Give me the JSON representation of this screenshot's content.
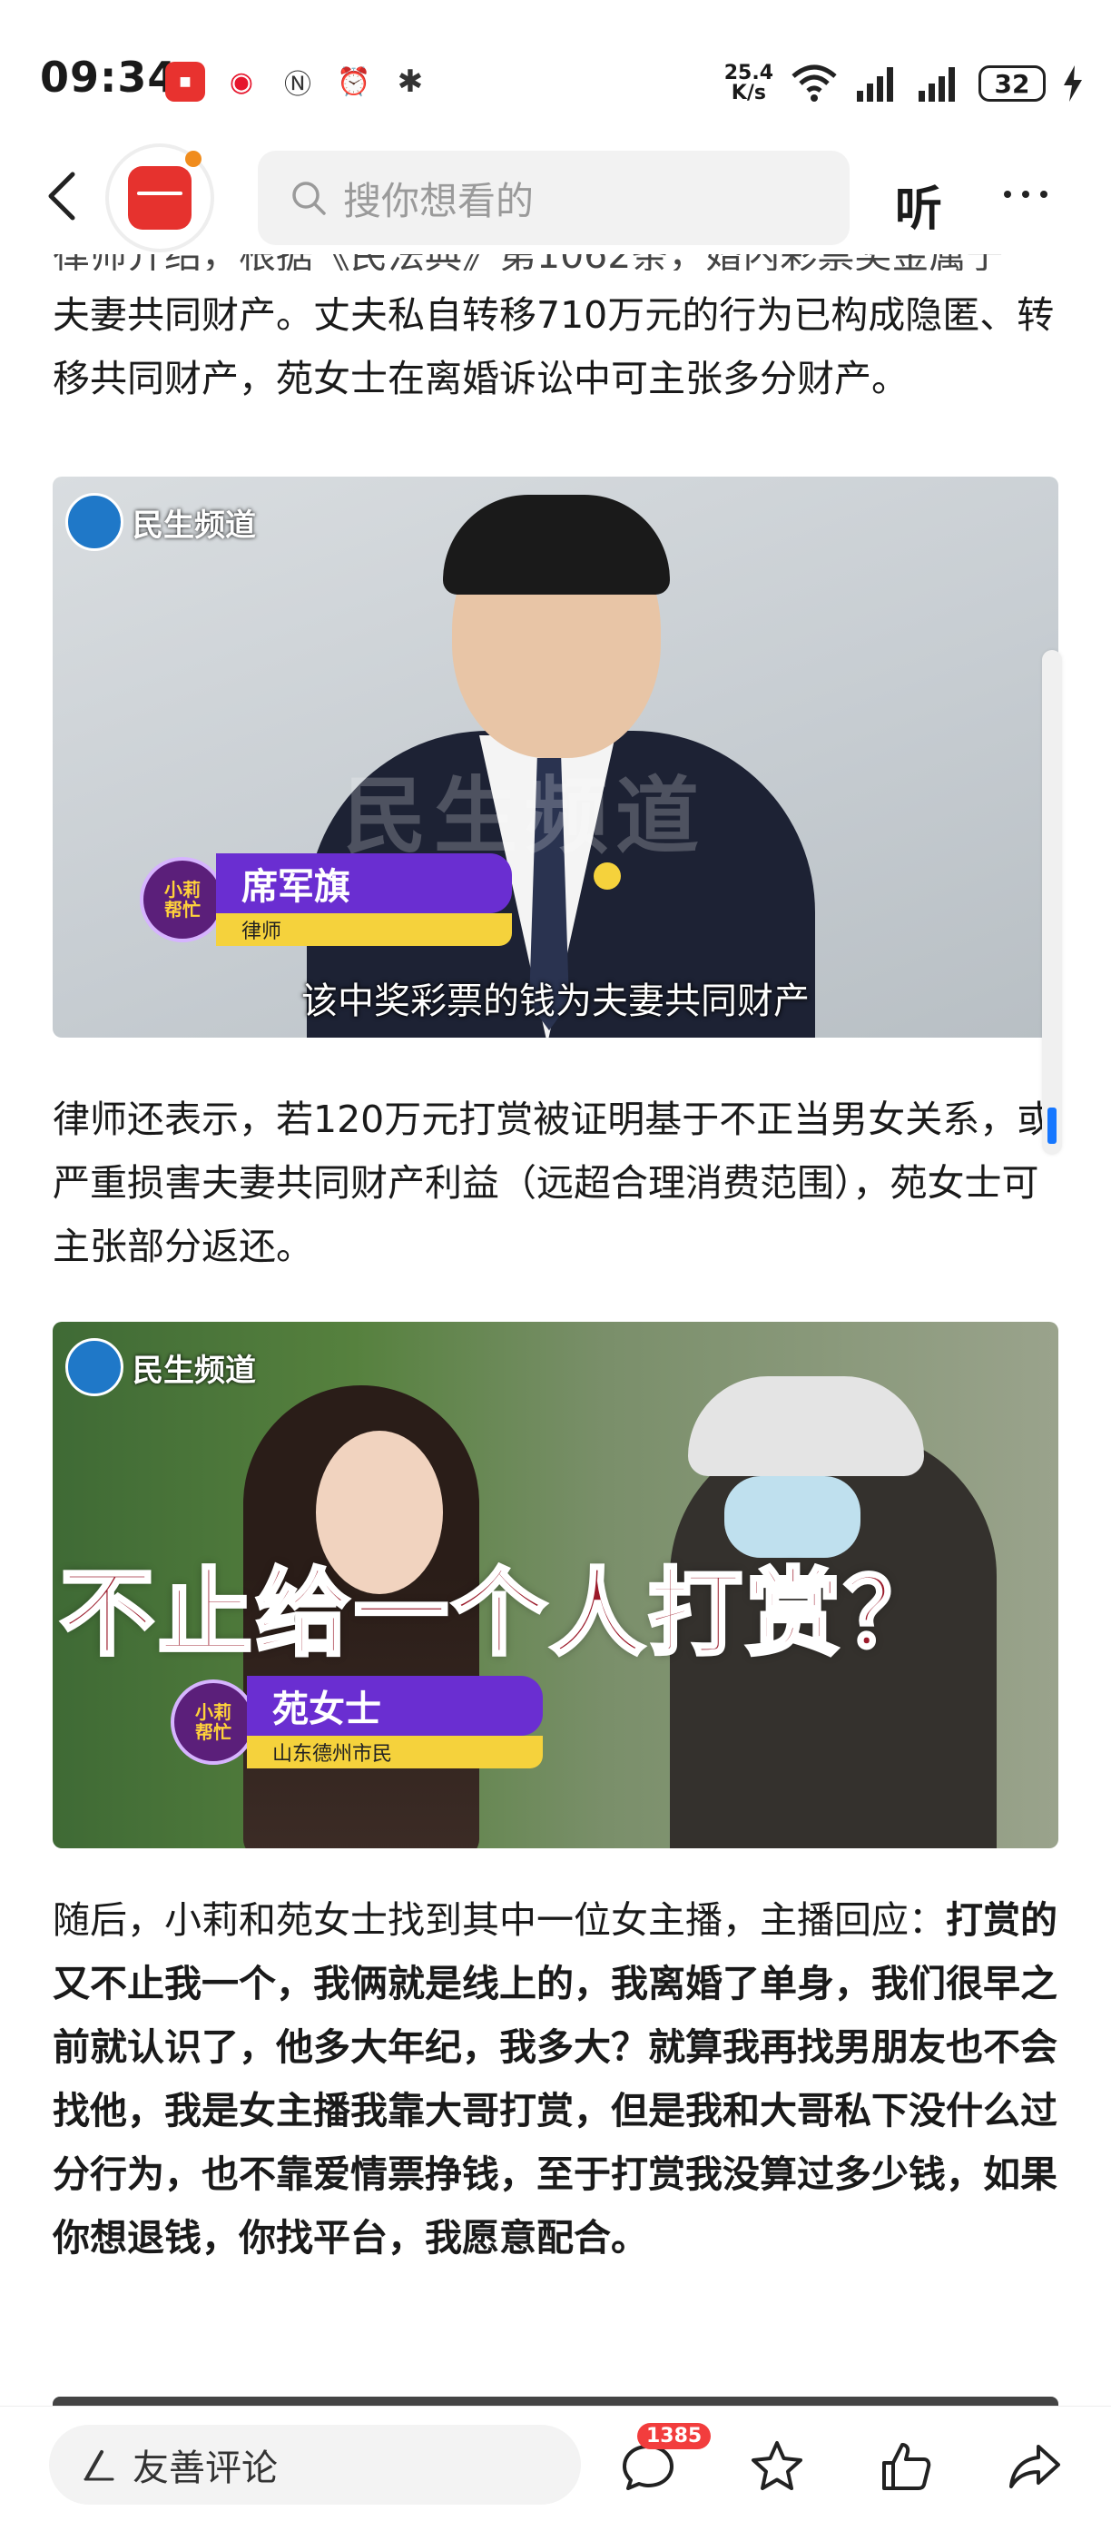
{
  "status_bar": {
    "time": "09:34",
    "net_speed": "25.4",
    "net_unit": "K/s",
    "battery": "32"
  },
  "nav": {
    "search_placeholder": "搜你想看的",
    "listen_label": "听"
  },
  "article": {
    "partial_line": "律师介绍，根据《民法典》第1062条，婚内彩票奖金属于",
    "para1": "夫妻共同财产。丈夫私自转移710万元的行为已构成隐匿、转移共同财产，苑女士在离婚诉讼中可主张多分财产。",
    "image1": {
      "channel_logo": "民生频道",
      "watermark": "民生频道",
      "person_name": "席军旗",
      "person_role": "律师",
      "subtitle": "该中奖彩票的钱为夫妻共同财产"
    },
    "para2": "律师还表示，若120万元打赏被证明基于不正当男女关系，或严重损害夫妻共同财产利益（远超合理消费范围），苑女士可主张部分返还。",
    "image2": {
      "channel_logo": "民生频道",
      "caption": "不止给一个人打赏？",
      "person_name": "苑女士",
      "person_role": "山东德州市民"
    },
    "para3_lead": "随后，小莉和苑女士找到其中一位女主播，主播回应：",
    "para3_bold": "打赏的又不止我一个，我俩就是线上的，我离婚了单身，我们很早之前就认识了，他多大年纪，我多大？就算我再找男朋友也不会找他，我是女主播我靠大哥打赏，但是我和大哥私下没什么过分行为，也不靠爱情票挣钱，至于打赏我没算过多少钱，如果你想退钱，你找平台，我愿意配合。"
  },
  "bottom_bar": {
    "comment_placeholder": "友善评论",
    "comment_count": "1385"
  },
  "colors": {
    "accent_blue": "#1677ff",
    "badge_red": "#f23d3d",
    "brand_red": "#e6322e"
  }
}
